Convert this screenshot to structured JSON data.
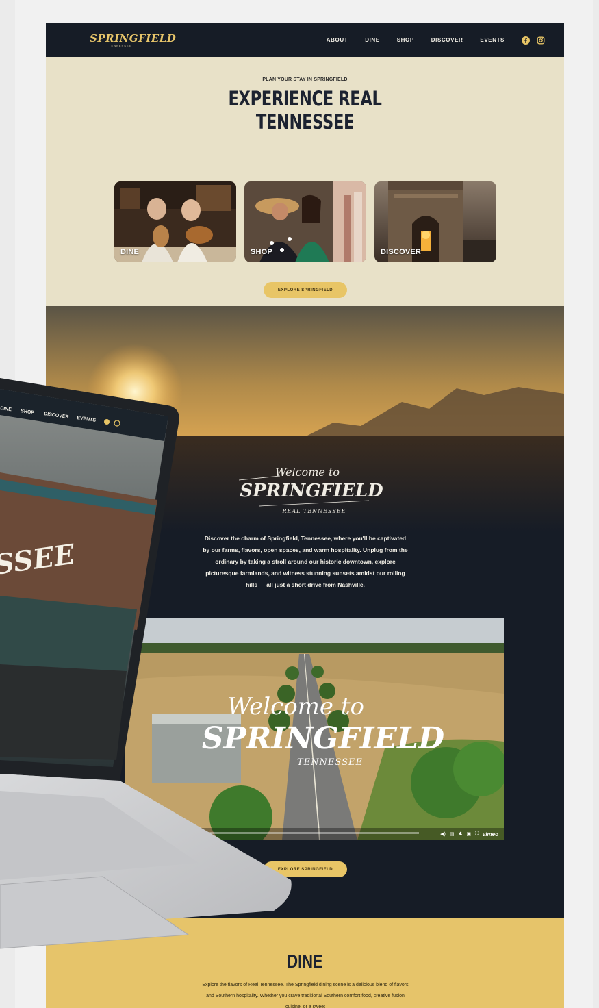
{
  "nav": {
    "logo": "SPRINGFIELD",
    "logo_sub": "TENNESSEE",
    "items": [
      "ABOUT",
      "DINE",
      "SHOP",
      "DISCOVER",
      "EVENTS"
    ],
    "social_icons": [
      "facebook-icon",
      "instagram-icon"
    ]
  },
  "hero": {
    "eyebrow": "PLAN YOUR STAY IN SPRINGFIELD",
    "title_line1": "EXPERIENCE REAL",
    "title_line2": "TENNESSEE",
    "cards": [
      {
        "label": "DINE"
      },
      {
        "label": "SHOP"
      },
      {
        "label": "DISCOVER"
      }
    ],
    "cta": "EXPLORE SPRINGFIELD"
  },
  "welcome": {
    "line1": "Welcome to",
    "line2": "SPRINGFIELD",
    "line3": "REAL TENNESSEE",
    "intro": "Discover the charm of Springfield, Tennessee, where you'll be captivated by our farms, flavors, open spaces, and warm hospitality. Unplug from the ordinary by taking a stroll around our historic downtown, explore picturesque farmlands, and witness stunning sunsets amidst our rolling hills — all just a short drive from Nashville.",
    "cta": "EXPLORE SPRINGFIELD"
  },
  "video": {
    "line1": "Welcome to",
    "line2": "SPRINGFIELD",
    "line3": "TENNESSEE",
    "player_brand": "vimeo"
  },
  "dine": {
    "title": "DINE",
    "text": "Explore the flavors of Real Tennessee. The Springfield dining scene is a delicious blend of flavors and Southern hospitality. Whether you crave traditional Southern comfort food, creative fusion cuisine, or a sweet"
  },
  "laptop": {
    "nav_items": [
      "DINE",
      "SHOP",
      "DISCOVER",
      "EVENTS"
    ],
    "headline_fragment": "SSEE"
  },
  "colors": {
    "navy": "#161c26",
    "cream": "#e8e1c8",
    "gold": "#e8c566"
  }
}
